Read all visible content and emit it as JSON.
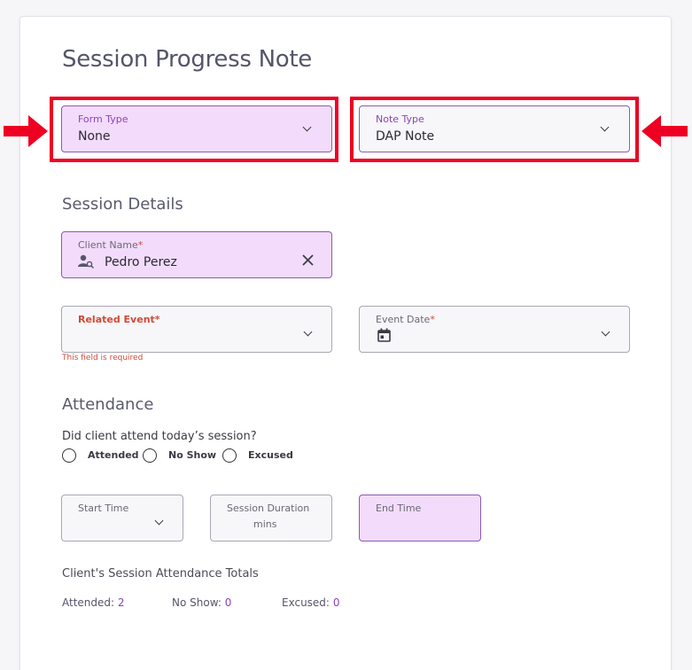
{
  "page": {
    "title": "Session Progress Note"
  },
  "form_type": {
    "label": "Form Type",
    "value": "None"
  },
  "note_type": {
    "label": "Note Type",
    "value": "DAP Note"
  },
  "session_details": {
    "heading": "Session Details",
    "client_name": {
      "label": "Client Name",
      "required_mark": "*",
      "value": "Pedro Perez"
    },
    "related_event": {
      "label": "Related Event",
      "required_mark": "*",
      "error": "This field is required"
    },
    "event_date": {
      "label": "Event Date",
      "required_mark": "*"
    }
  },
  "attendance": {
    "heading": "Attendance",
    "question": "Did client attend today’s session?",
    "options": [
      "Attended",
      "No Show",
      "Excused"
    ],
    "start_time": {
      "label": "Start Time"
    },
    "session_duration": {
      "label": "Session Duration",
      "unit": "mins"
    },
    "end_time": {
      "label": "End Time"
    }
  },
  "totals": {
    "heading": "Client's Session Attendance Totals",
    "attended_label": "Attended:",
    "attended_value": "2",
    "noshow_label": "No Show:",
    "noshow_value": "0",
    "excused_label": "Excused:",
    "excused_value": "0"
  },
  "colors": {
    "accent": "#8a45b8",
    "highlight": "#ee0022",
    "field_fill": "#f3dbfb",
    "error": "#d14a34"
  },
  "icons": [
    "arrow-right-icon",
    "arrow-left-icon",
    "client-search-icon",
    "close-icon",
    "calendar-icon",
    "chevron-down-icon"
  ]
}
